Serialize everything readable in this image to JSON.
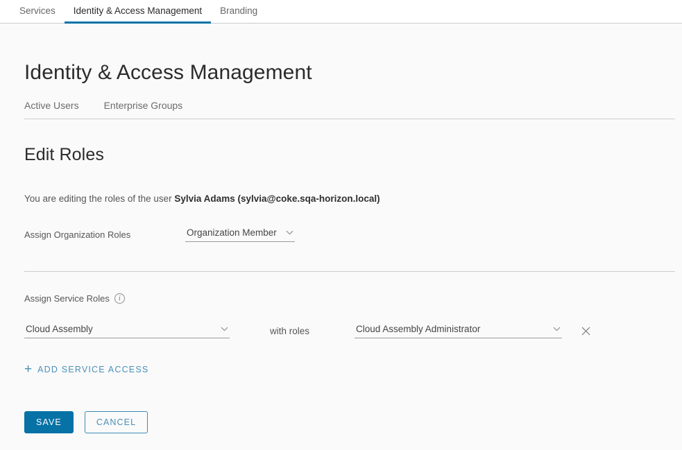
{
  "topnav": {
    "tabs": [
      {
        "label": "Services",
        "active": false
      },
      {
        "label": "Identity & Access Management",
        "active": true
      },
      {
        "label": "Branding",
        "active": false
      }
    ]
  },
  "page": {
    "title": "Identity & Access Management",
    "subtabs": [
      {
        "label": "Active Users"
      },
      {
        "label": "Enterprise Groups"
      }
    ]
  },
  "edit_roles": {
    "heading": "Edit Roles",
    "description_prefix": "You are editing the roles of the user ",
    "user": "Sylvia Adams (sylvia@coke.sqa-horizon.local)",
    "org_roles": {
      "label": "Assign Organization Roles",
      "selected": "Organization Member"
    },
    "service_roles": {
      "label": "Assign Service Roles",
      "info_icon": "info-icon",
      "info_glyph": "i",
      "with_roles_label": "with roles",
      "rows": [
        {
          "service": "Cloud Assembly",
          "role": "Cloud Assembly Administrator",
          "remove_icon": "close-icon"
        }
      ],
      "add_label": "Add Service Access",
      "add_icon": "plus-icon",
      "add_glyph": "+"
    },
    "actions": {
      "save_label": "Save",
      "cancel_label": "Cancel"
    }
  },
  "colors": {
    "accent": "#0672a6",
    "link": "#4a90b9",
    "page_bg": "#fafafa",
    "header_bg": "#ffffff",
    "divider": "#cdcdcd"
  }
}
